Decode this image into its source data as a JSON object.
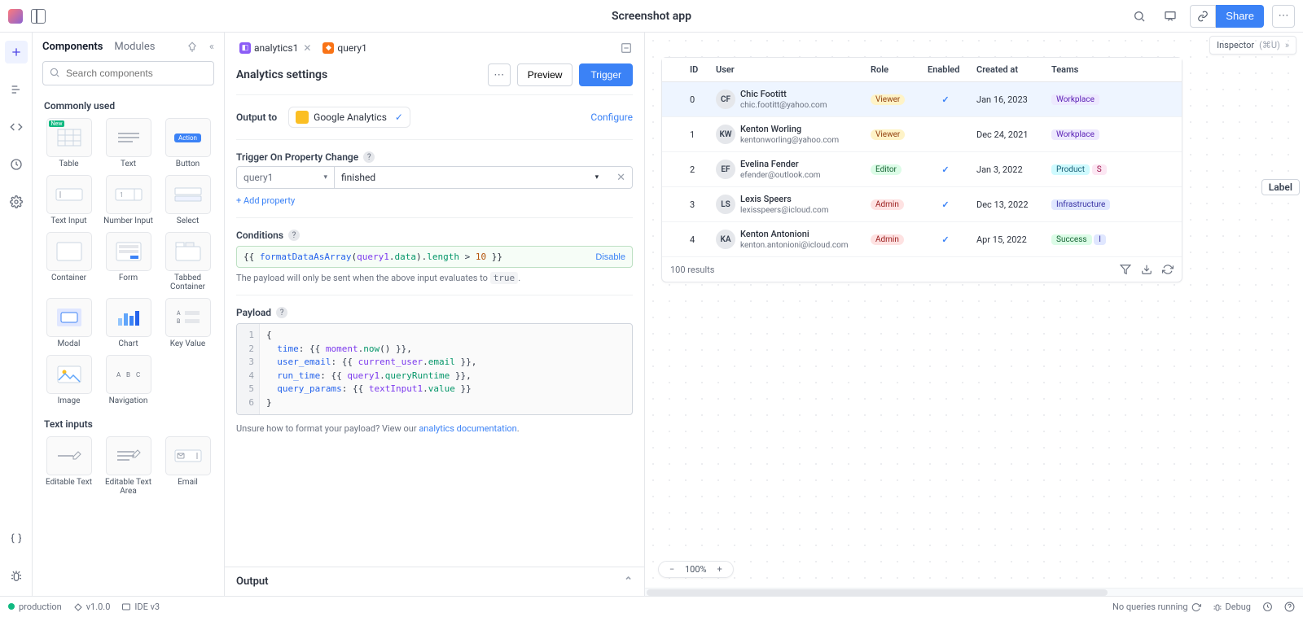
{
  "topbar": {
    "title": "Screenshot app",
    "share_label": "Share"
  },
  "inspector": {
    "label": "Inspector",
    "shortcut": "(⌘U)"
  },
  "sidebar": {
    "tabs": {
      "components": "Components",
      "modules": "Modules"
    },
    "search_placeholder": "Search components",
    "section_commonly_used": "Commonly used",
    "section_text_inputs": "Text inputs",
    "tiles": {
      "table": "Table",
      "text": "Text",
      "button": "Button",
      "action_chip": "Action",
      "text_input": "Text Input",
      "number_input": "Number Input",
      "select": "Select",
      "container": "Container",
      "form": "Form",
      "tabbed": "Tabbed Container",
      "modal": "Modal",
      "chart": "Chart",
      "key_value": "Key Value",
      "image": "Image",
      "navigation": "Navigation",
      "editable_text": "Editable Text",
      "editable_area": "Editable Text Area",
      "email": "Email"
    }
  },
  "editor": {
    "crumbs": {
      "analytics": "analytics1",
      "query": "query1"
    },
    "title": "Analytics settings",
    "buttons": {
      "preview": "Preview",
      "trigger": "Trigger"
    },
    "output_to_label": "Output to",
    "output_to_chip": "Google Analytics",
    "configure": "Configure",
    "trigger_on_label": "Trigger On Property Change",
    "trigger_row": {
      "target": "query1",
      "property": "finished"
    },
    "add_property": "+ Add property",
    "conditions_label": "Conditions",
    "condition_expr": {
      "open": "{{ ",
      "fn": "formatDataAsArray",
      "lp": "(",
      "var1": "query1",
      "dot1": ".",
      "prop1": "data",
      "rp": ")",
      "dot2": ".",
      "prop2": "length",
      "op": " > ",
      "num": "10",
      "close": " }}"
    },
    "disable": "Disable",
    "conditions_hint_pre": "The payload will only be sent when the above input evaluates to ",
    "conditions_hint_code": "true",
    "conditions_hint_post": ".",
    "payload_label": "Payload",
    "payload_lines": [
      "1",
      "2",
      "3",
      "4",
      "5",
      "6"
    ],
    "payload_code": "{\n  time: {{ moment.now() }},\n  user_email: {{ current_user.email }},\n  run_time: {{ query1.queryRuntime }},\n  query_params: {{ textInput1.value }}\n}",
    "footnote_pre": "Unsure how to format your payload? View our ",
    "footnote_link": "analytics documentation",
    "footnote_post": ".",
    "output_label": "Output"
  },
  "table": {
    "columns": [
      "",
      "ID",
      "User",
      "Role",
      "Enabled",
      "Created at",
      "Teams"
    ],
    "rows": [
      {
        "id": "0",
        "initials": "CF",
        "name": "Chic Footitt",
        "email": "chic.footitt@yahoo.com",
        "role": "Viewer",
        "enabled": true,
        "created": "Jan 16, 2023",
        "teams": [
          "Workplace"
        ]
      },
      {
        "id": "1",
        "initials": "KW",
        "name": "Kenton Worling",
        "email": "kentonworling@yahoo.com",
        "role": "Viewer",
        "enabled": false,
        "created": "Dec 24, 2021",
        "teams": [
          "Workplace"
        ]
      },
      {
        "id": "2",
        "initials": "EF",
        "name": "Evelina Fender",
        "email": "efender@outlook.com",
        "role": "Editor",
        "enabled": true,
        "created": "Jan 3, 2022",
        "teams": [
          "Product",
          "S"
        ]
      },
      {
        "id": "3",
        "initials": "LS",
        "name": "Lexis Speers",
        "email": "lexisspeers@icloud.com",
        "role": "Admin",
        "enabled": true,
        "created": "Dec 13, 2022",
        "teams": [
          "Infrastructure"
        ]
      },
      {
        "id": "4",
        "initials": "KA",
        "name": "Kenton Antonioni",
        "email": "kenton.antonioni@icloud.com",
        "role": "Admin",
        "enabled": true,
        "created": "Apr 15, 2022",
        "teams": [
          "Success",
          "I"
        ]
      }
    ],
    "footer_text": "100 results"
  },
  "label_widget": "Label",
  "zoom": {
    "value": "100%"
  },
  "footer": {
    "env": "production",
    "version": "v1.0.0",
    "ide": "IDE v3",
    "queries": "No queries running",
    "debug": "Debug"
  }
}
